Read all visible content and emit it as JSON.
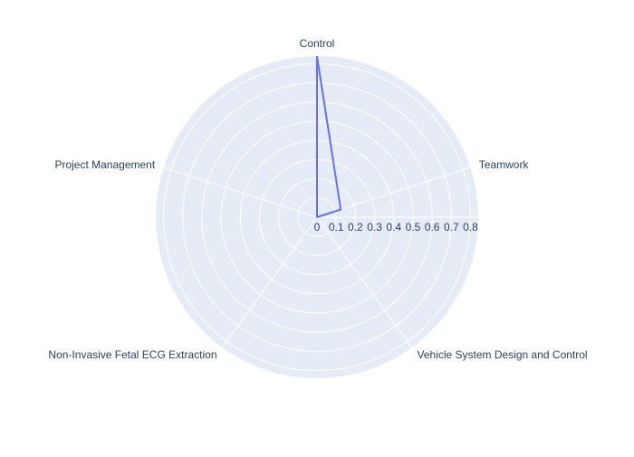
{
  "chart_data": {
    "type": "radar",
    "axes": [
      "Control",
      "Teamwork",
      "Vehicle System Design and Control",
      "Non-Invasive Fetal ECG Extraction",
      "Project Management"
    ],
    "values": [
      0.84,
      0.13,
      0,
      0,
      0
    ],
    "radial_ticks": [
      "0",
      "0.1",
      "0.2",
      "0.3",
      "0.4",
      "0.5",
      "0.6",
      "0.7",
      "0.8"
    ],
    "radial_range": [
      0,
      0.84
    ],
    "grid": true,
    "colors": {
      "background": "#e5ecf6",
      "grid": "#ffffff",
      "line": "#636efa",
      "text": "#2a3f5f"
    }
  }
}
